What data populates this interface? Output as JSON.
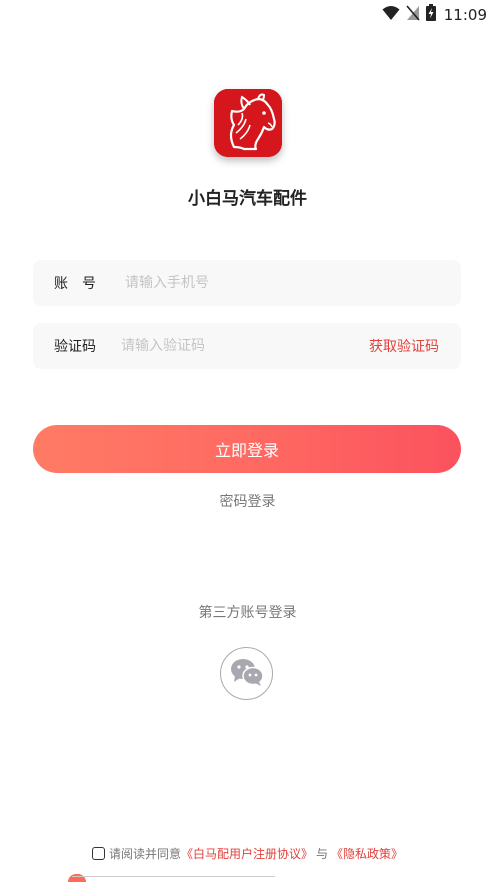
{
  "status_bar": {
    "time": "11:09",
    "icons": [
      "wifi-icon",
      "no-sim-icon",
      "battery-charging-icon"
    ]
  },
  "app": {
    "name": "小白马汽车配件",
    "logo_icon": "white-horse-logo",
    "brand_color": "#d5161c"
  },
  "account_field": {
    "label": "账　号",
    "placeholder": "请输入手机号",
    "value": ""
  },
  "code_field": {
    "label": "验证码",
    "placeholder": "请输入验证码",
    "value": "",
    "get_code_label": "获取验证码"
  },
  "login_button": {
    "label": "立即登录",
    "gradient": [
      "#ff7b65",
      "#fb525e"
    ]
  },
  "password_login_label": "密码登录",
  "third_party": {
    "title": "第三方账号登录",
    "wechat_icon": "wechat-icon"
  },
  "agreement": {
    "prefix": "请阅读并同意",
    "user_agreement": "《白马配用户注册协议》",
    "conjunction": "与",
    "privacy_policy": "《隐私政策》",
    "checked": false
  },
  "colors": {
    "accent": "#e2403a",
    "muted_text": "#777777",
    "placeholder": "#c4c4c4",
    "field_bg": "#f8f8f8"
  }
}
